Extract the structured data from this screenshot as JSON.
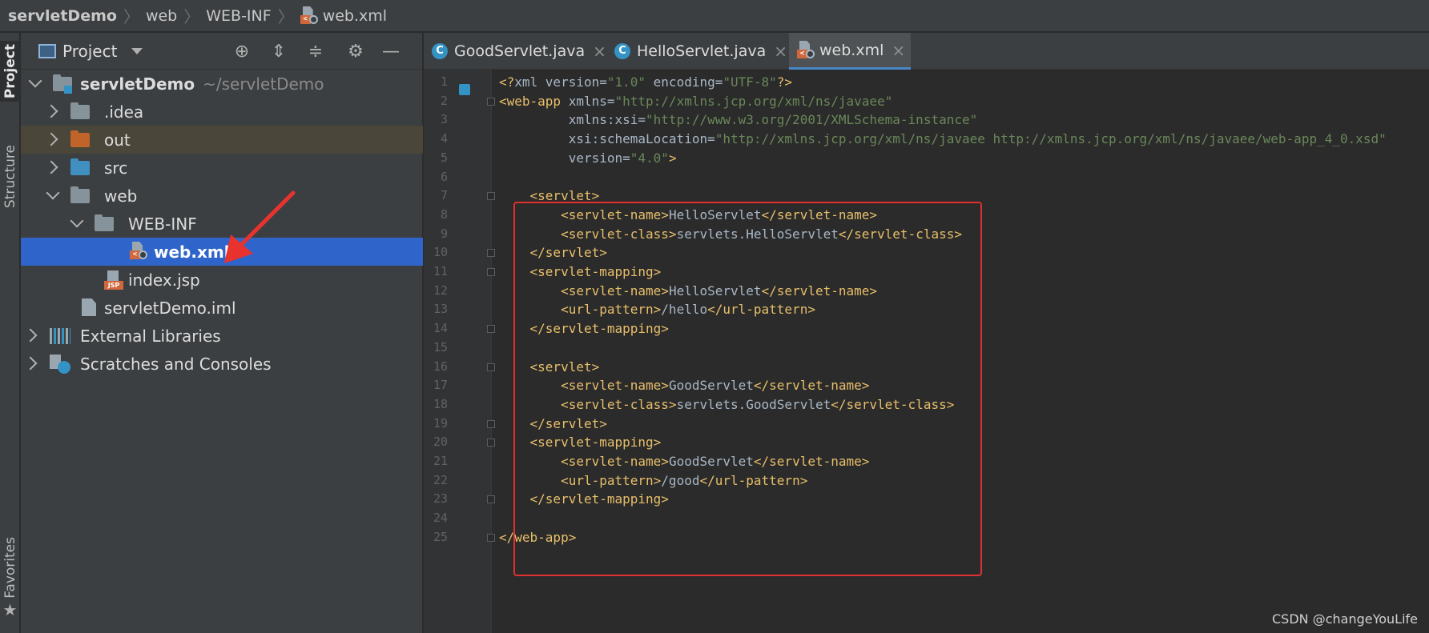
{
  "breadcrumb": [
    "servletDemo",
    "web",
    "WEB-INF",
    "web.xml"
  ],
  "sidebar_labels": {
    "project": "Project",
    "structure": "Structure",
    "favorites": "Favorites"
  },
  "project_panel": {
    "title": "Project",
    "tree": [
      {
        "label": "servletDemo",
        "hint": "~/servletDemo",
        "icon": "module-folder-icon",
        "expanded": true
      },
      {
        "label": ".idea",
        "icon": "folder-icon",
        "expanded": false
      },
      {
        "label": "out",
        "icon": "excluded-folder-icon",
        "expanded": false
      },
      {
        "label": "src",
        "icon": "source-folder-icon",
        "expanded": false
      },
      {
        "label": "web",
        "icon": "web-folder-icon",
        "expanded": true
      },
      {
        "label": "WEB-INF",
        "icon": "folder-icon",
        "expanded": true
      },
      {
        "label": "web.xml",
        "icon": "xml-file-icon",
        "selected": true
      },
      {
        "label": "index.jsp",
        "icon": "jsp-file-icon"
      },
      {
        "label": "servletDemo.iml",
        "icon": "iml-file-icon"
      },
      {
        "label": "External Libraries",
        "icon": "libraries-icon",
        "expanded": false
      },
      {
        "label": "Scratches and Consoles",
        "icon": "scratches-icon",
        "expanded": false
      }
    ]
  },
  "tabs": [
    {
      "label": "GoodServlet.java",
      "icon": "java-class-icon"
    },
    {
      "label": "HelloServlet.java",
      "icon": "java-class-icon"
    },
    {
      "label": "web.xml",
      "icon": "xml-file-icon",
      "active": true
    }
  ],
  "code_lines": [
    "<?xml version=\"1.0\" encoding=\"UTF-8\"?>",
    "<web-app xmlns=\"http://xmlns.jcp.org/xml/ns/javaee\"",
    "         xmlns:xsi=\"http://www.w3.org/2001/XMLSchema-instance\"",
    "         xsi:schemaLocation=\"http://xmlns.jcp.org/xml/ns/javaee http://xmlns.jcp.org/xml/ns/javaee/web-app_4_0.xsd\"",
    "         version=\"4.0\">",
    "",
    "    <servlet>",
    "        <servlet-name>HelloServlet</servlet-name>",
    "        <servlet-class>servlets.HelloServlet</servlet-class>",
    "    </servlet>",
    "    <servlet-mapping>",
    "        <servlet-name>HelloServlet</servlet-name>",
    "        <url-pattern>/hello</url-pattern>",
    "    </servlet-mapping>",
    "",
    "    <servlet>",
    "        <servlet-name>GoodServlet</servlet-name>",
    "        <servlet-class>servlets.GoodServlet</servlet-class>",
    "    </servlet>",
    "    <servlet-mapping>",
    "        <servlet-name>GoodServlet</servlet-name>",
    "        <url-pattern>/good</url-pattern>",
    "    </servlet-mapping>",
    "",
    "</web-app>"
  ],
  "watermark": "CSDN @changeYouLife",
  "colors": {
    "selection": "#2f65ca",
    "tag": "#e8bf6a",
    "string": "#6a8759",
    "namespace": "#9876aa",
    "highlight_box": "#e03030"
  }
}
